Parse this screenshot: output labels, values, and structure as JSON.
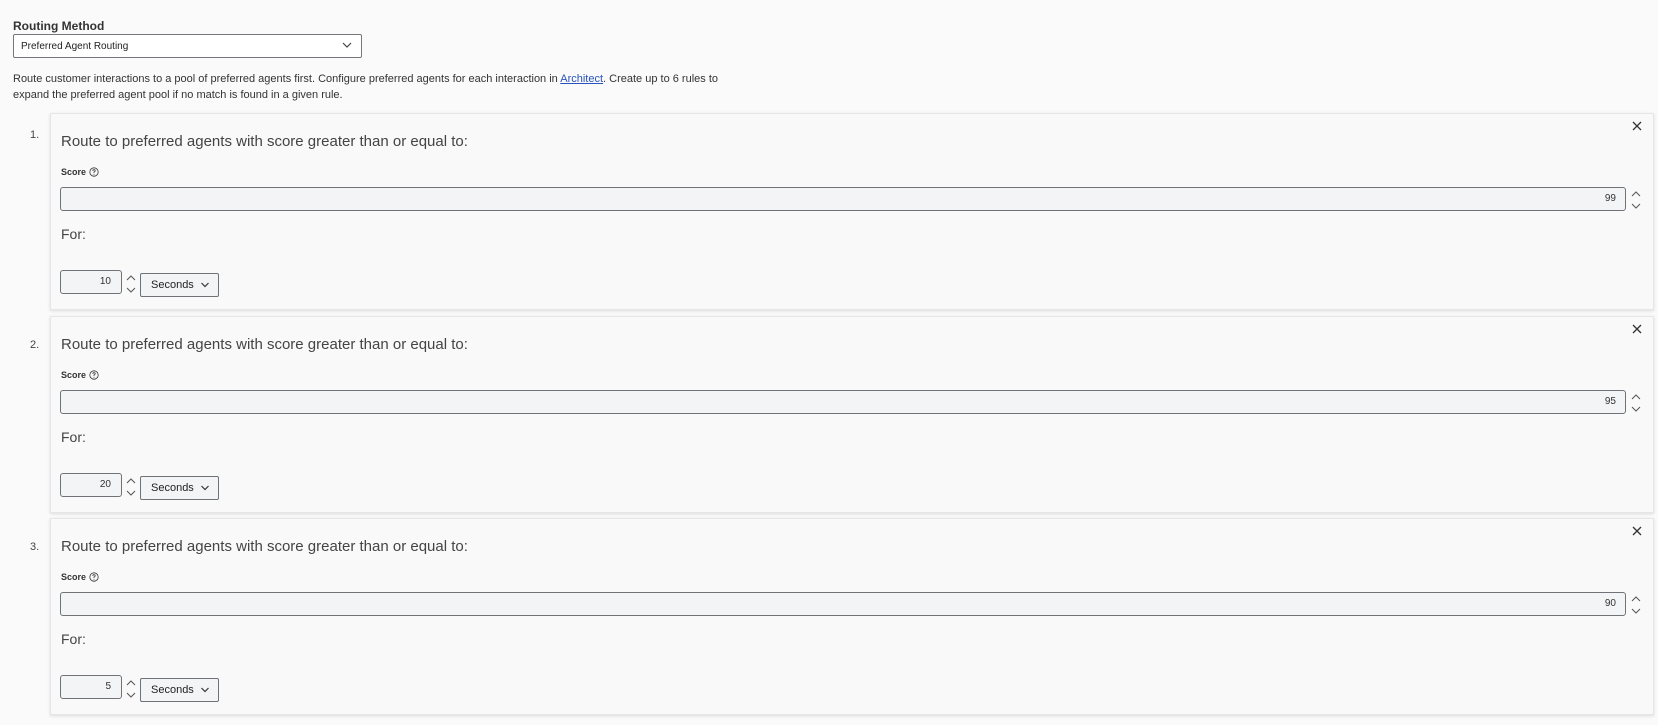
{
  "routing_method": {
    "label": "Routing Method",
    "selected": "Preferred Agent Routing"
  },
  "description": {
    "before_link": "Route customer interactions to a pool of preferred agents first. Configure preferred agents for each interaction in ",
    "link_text": "Architect",
    "after_link": ". Create up to 6 rules to expand the preferred agent pool if no match is found in a given rule."
  },
  "rules": [
    {
      "number": "1.",
      "title": "Route to preferred agents with score greater than or equal to:",
      "score_label": "Score",
      "score": "99",
      "for_label": "For:",
      "duration": "10",
      "unit": "Seconds"
    },
    {
      "number": "2.",
      "title": "Route to preferred agents with score greater than or equal to:",
      "score_label": "Score",
      "score": "95",
      "for_label": "For:",
      "duration": "20",
      "unit": "Seconds"
    },
    {
      "number": "3.",
      "title": "Route to preferred agents with score greater than or equal to:",
      "score_label": "Score",
      "score": "90",
      "for_label": "For:",
      "duration": "5",
      "unit": "Seconds"
    }
  ],
  "icons": {
    "close": "close-icon",
    "help": "help-icon",
    "chevron": "chevron-down-icon",
    "spinner": "spinner-arrows-icon"
  }
}
